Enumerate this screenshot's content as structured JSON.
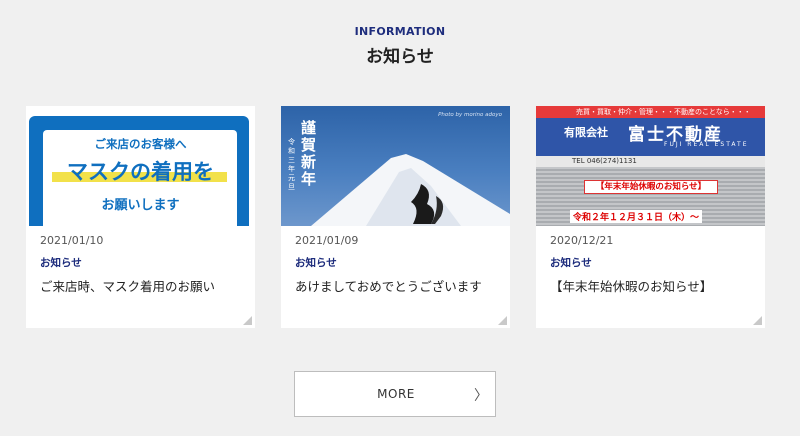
{
  "section": {
    "label": "INFORMATION",
    "title": "お知らせ"
  },
  "news": [
    {
      "date": "2021/01/10",
      "category": "お知らせ",
      "title": "ご来店時、マスク着用のお願い",
      "image": {
        "line1": "ご来店のお客様へ",
        "line2": "マスクの着用を",
        "line3": "お願いします"
      }
    },
    {
      "date": "2021/01/09",
      "category": "お知らせ",
      "title": "あけましておめでとうございます",
      "image": {
        "greeting": "謹賀新年",
        "era": "令和三年 元旦",
        "caption": "Photo by morino adoyo"
      }
    },
    {
      "date": "2020/12/21",
      "category": "お知らせ",
      "title": "【年末年始休暇のお知らせ】",
      "image": {
        "banner": "売買・買取・仲介・管理・・・不動産のことなら・・・",
        "company_type": "有限会社",
        "company_name": "富士不動産",
        "company_en": "FUJI REAL ESTATE",
        "tel": "TEL 046(274)1131",
        "notice": "【年末年始休暇のお知らせ】",
        "notice_date": "令和２年１２月３１日（木）～"
      }
    }
  ],
  "more_button": {
    "label": "MORE",
    "chevron": "〉"
  },
  "colors": {
    "accent": "#1e2d7d",
    "background": "#f0f0f0"
  }
}
